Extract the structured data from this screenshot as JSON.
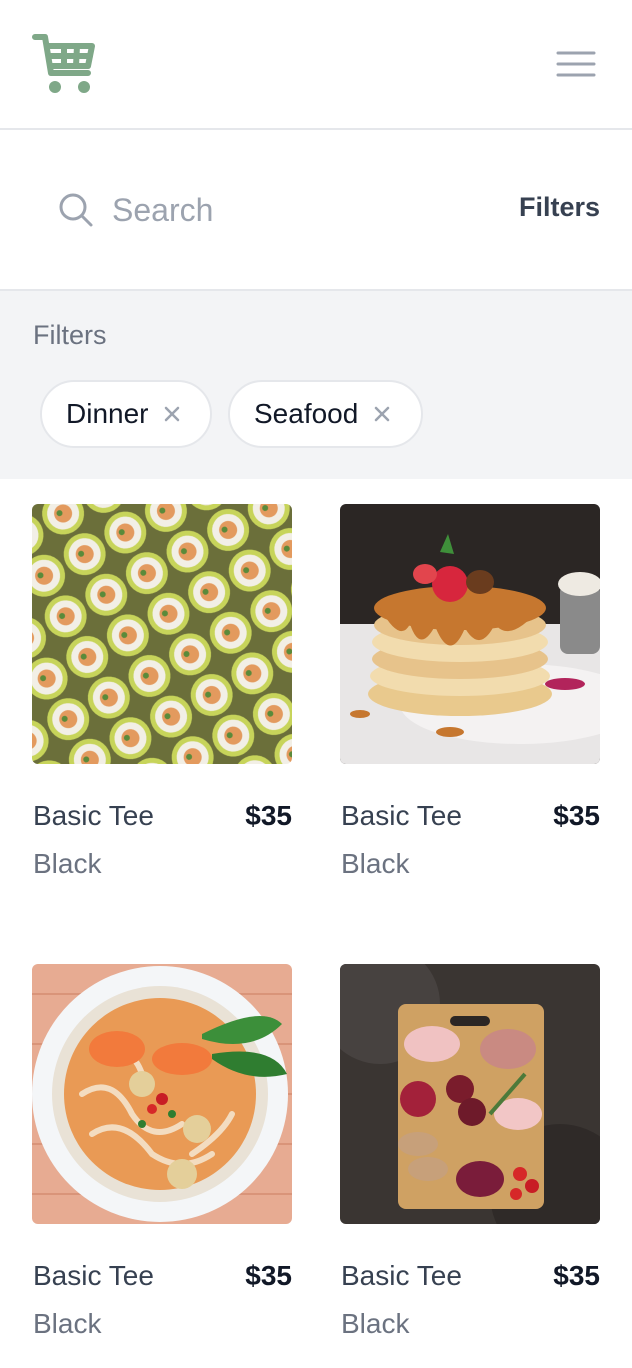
{
  "header": {
    "logo_icon": "shopping-cart-icon",
    "menu_icon": "hamburger-menu-icon",
    "logo_color": "#7fa888"
  },
  "search": {
    "placeholder": "Search",
    "value": "",
    "filters_label": "Filters"
  },
  "filters": {
    "title": "Filters",
    "chips": [
      {
        "label": "Dinner"
      },
      {
        "label": "Seafood"
      }
    ]
  },
  "products": [
    {
      "name": "Basic Tee",
      "price": "$35",
      "color": "Black",
      "image": "sushi-rolls"
    },
    {
      "name": "Basic Tee",
      "price": "$35",
      "color": "Black",
      "image": "pancake-stack"
    },
    {
      "name": "Basic Tee",
      "price": "$35",
      "color": "Black",
      "image": "shrimp-noodle-soup"
    },
    {
      "name": "Basic Tee",
      "price": "$35",
      "color": "Black",
      "image": "charcuterie-board"
    }
  ]
}
